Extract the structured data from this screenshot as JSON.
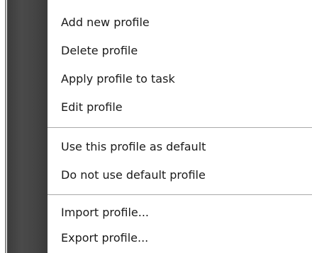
{
  "context_menu": {
    "group1": {
      "add_new_profile": "Add new profile",
      "delete_profile": "Delete profile",
      "apply_profile_to_task": "Apply profile to task",
      "edit_profile": "Edit profile"
    },
    "group2": {
      "use_profile_as_default": "Use this profile as default",
      "do_not_use_default_profile": "Do not use default profile"
    },
    "group3": {
      "import_profile": "Import profile...",
      "export_profile": "Export profile..."
    }
  },
  "colors": {
    "gutter": "#444444",
    "separator": "#a9a9a9",
    "text": "#1a1a1a",
    "background": "#ffffff"
  }
}
